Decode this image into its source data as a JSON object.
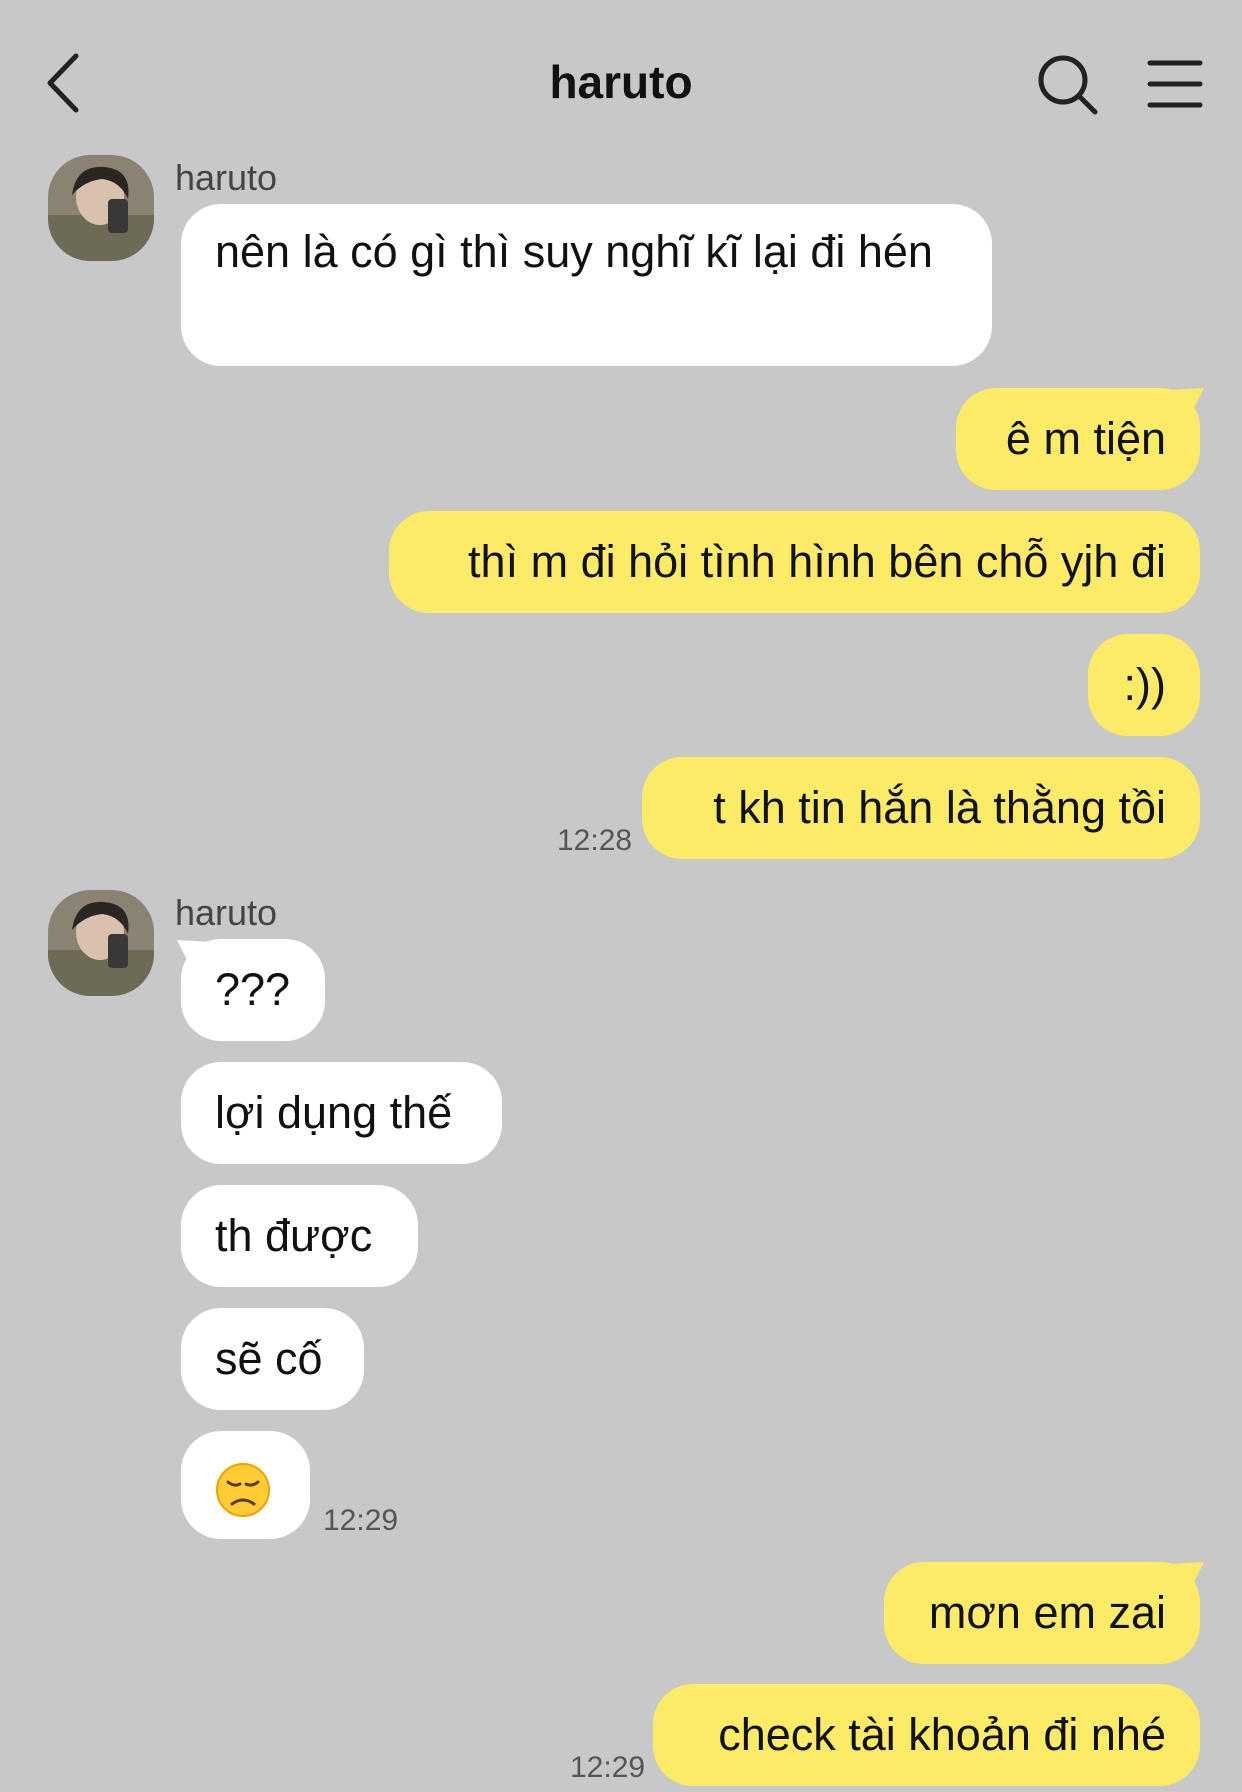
{
  "header": {
    "title": "haruto"
  },
  "messages": {
    "g1": {
      "sender": "haruto",
      "m1": "nên là có gì thì suy nghĩ kĩ lại đi hén"
    },
    "g2": {
      "m1": "ê m tiện",
      "m2": "thì m đi hỏi tình hình bên chỗ yjh đi",
      "m3": ":))",
      "m4": "t kh tin hắn là thằng tồi",
      "time": "12:28"
    },
    "g3": {
      "sender": "haruto",
      "m1": "???",
      "m2": "lợi dụng thế",
      "m3": "th được",
      "m4": "sẽ cố",
      "m5": "😞",
      "time": "12:29"
    },
    "g4": {
      "m1": "mơn em zai",
      "m2": "check tài khoản đi nhé",
      "time": "12:29"
    }
  },
  "colors": {
    "background": "#c8c8c8",
    "incoming_bubble": "#ffffff",
    "outgoing_bubble": "#fbeb66"
  },
  "icons": {
    "back": "chevron-left-icon",
    "search": "search-icon",
    "menu": "menu-icon"
  }
}
